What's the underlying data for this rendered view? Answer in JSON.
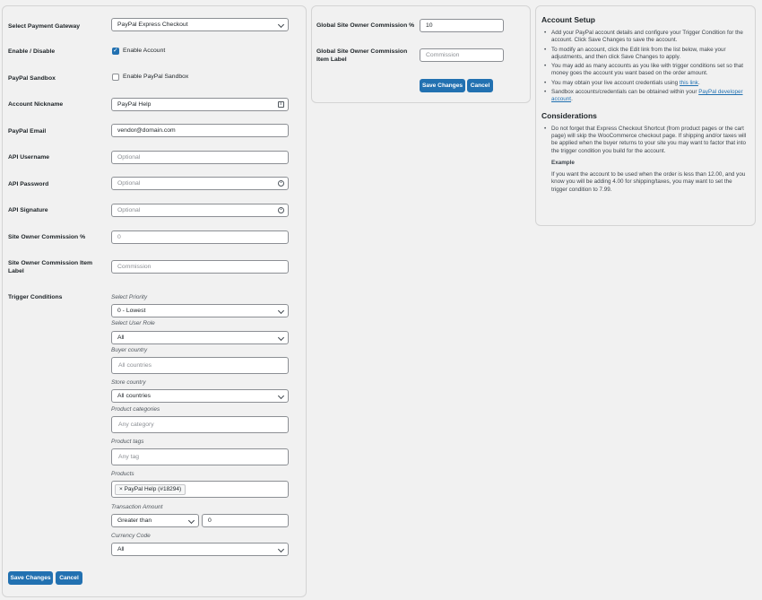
{
  "left": {
    "fields": {
      "gateway": {
        "label": "Select Payment Gateway",
        "value": "PayPal Express Checkout"
      },
      "enable": {
        "label": "Enable / Disable",
        "checkbox": "Enable Account",
        "checked": true
      },
      "sandbox": {
        "label": "PayPal Sandbox",
        "checkbox": "Enable PayPal Sandbox",
        "checked": false
      },
      "nickname": {
        "label": "Account Nickname",
        "value": "PayPal Help"
      },
      "email": {
        "label": "PayPal Email",
        "value": "vendor@domain.com"
      },
      "username": {
        "label": "API Username",
        "placeholder": "Optional"
      },
      "password": {
        "label": "API Password",
        "placeholder": "Optional"
      },
      "signature": {
        "label": "API Signature",
        "placeholder": "Optional"
      },
      "commission": {
        "label": "Site Owner Commission %",
        "placeholder": "0"
      },
      "commission_label": {
        "label": "Site Owner Commission Item Label",
        "placeholder": "Commission"
      }
    },
    "trigger": {
      "label": "Trigger Conditions",
      "priority": {
        "label": "Select Priority",
        "value": "0 - Lowest"
      },
      "user_role": {
        "label": "Select User Role",
        "value": "All"
      },
      "buyer_country": {
        "label": "Buyer country",
        "placeholder": "All countries"
      },
      "store_country": {
        "label": "Store country",
        "value": "All countries"
      },
      "product_categories": {
        "label": "Product categories",
        "placeholder": "Any category"
      },
      "product_tags": {
        "label": "Product tags",
        "placeholder": "Any tag"
      },
      "products": {
        "label": "Products",
        "tag": "× PayPal Help (#18294)"
      },
      "amount": {
        "label": "Transaction Amount",
        "operator": "Greater than",
        "value": "0"
      },
      "currency": {
        "label": "Currency Code",
        "value": "All"
      }
    },
    "buttons": {
      "save": "Save Changes",
      "cancel": "Cancel"
    }
  },
  "mid": {
    "global_commission": {
      "label": "Global Site Owner Commission %",
      "value": "10"
    },
    "global_label": {
      "label": "Global Site Owner Commission Item Label",
      "placeholder": "Commission"
    },
    "buttons": {
      "save": "Save Changes",
      "cancel": "Cancel"
    }
  },
  "right": {
    "setup_title": "Account Setup",
    "setup_items": [
      "Add your PayPal account details and configure your Trigger Condition for the account. Click Save Changes to save the account.",
      "To modify an account, click the Edit link from the list below, make your adjustments, and then click Save Changes to apply.",
      "You may add as many accounts as you like with trigger conditions set so that money goes the account you want based on the order amount."
    ],
    "live_text": "You may obtain your live account credentials using ",
    "live_link": "this link",
    "sandbox_text": "Sandbox accounts/credentials can be obtained within your ",
    "sandbox_link": "PayPal developer account",
    "considerations_title": "Considerations",
    "considerations_item": "Do not forget that Express Checkout Shortcut (from product pages or the cart page) will skip the WooCommerce checkout page. If shipping and/or taxes will be applied when the buyer returns to your site you may want to factor that into the trigger condition you build for the account.",
    "example_title": "Example",
    "example_body": "If you want the account to be used when the order is less than 12.00, and you know you will be adding 4.00 for shipping/taxes, you may want to set the trigger condition to 7.99."
  }
}
